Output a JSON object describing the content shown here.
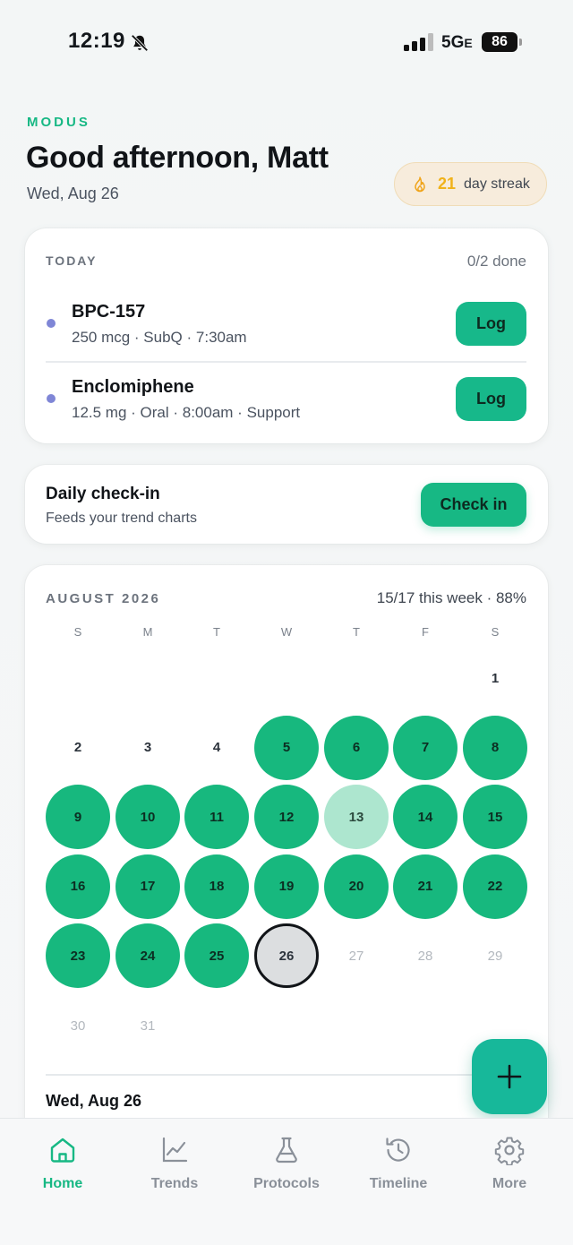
{
  "status_bar": {
    "time": "12:19",
    "network": "5G",
    "network_suffix": "E",
    "battery": "86"
  },
  "header": {
    "brand": "MODUS",
    "greeting": "Good afternoon, Matt",
    "date": "Wed, Aug 26",
    "streak_count": "21",
    "streak_label": "day streak"
  },
  "today": {
    "title": "TODAY",
    "progress": "0/2 done",
    "doses": [
      {
        "name": "BPC-157",
        "detail": "250 mcg · SubQ · 7:30am",
        "button": "Log",
        "dot_color": "#7f86d6"
      },
      {
        "name": "Enclomiphene",
        "detail": "12.5 mg · Oral · 8:00am · Support",
        "button": "Log",
        "dot_color": "#7f86d6"
      }
    ]
  },
  "checkin": {
    "title": "Daily check-in",
    "subtitle": "Feeds your trend charts",
    "button": "Check in"
  },
  "calendar": {
    "month": "AUGUST 2026",
    "summary": "15/17 this week · 88%",
    "weekdays": [
      "S",
      "M",
      "T",
      "W",
      "T",
      "F",
      "S"
    ],
    "days": [
      {
        "n": "1",
        "state": "plain"
      },
      {
        "n": "2",
        "state": "plain"
      },
      {
        "n": "3",
        "state": "plain"
      },
      {
        "n": "4",
        "state": "plain"
      },
      {
        "n": "5",
        "state": "done"
      },
      {
        "n": "6",
        "state": "done"
      },
      {
        "n": "7",
        "state": "done"
      },
      {
        "n": "8",
        "state": "done"
      },
      {
        "n": "9",
        "state": "done"
      },
      {
        "n": "10",
        "state": "done"
      },
      {
        "n": "11",
        "state": "done"
      },
      {
        "n": "12",
        "state": "done"
      },
      {
        "n": "13",
        "state": "partial"
      },
      {
        "n": "14",
        "state": "done"
      },
      {
        "n": "15",
        "state": "done"
      },
      {
        "n": "16",
        "state": "done"
      },
      {
        "n": "17",
        "state": "done"
      },
      {
        "n": "18",
        "state": "done"
      },
      {
        "n": "19",
        "state": "done"
      },
      {
        "n": "20",
        "state": "done"
      },
      {
        "n": "21",
        "state": "done"
      },
      {
        "n": "22",
        "state": "done"
      },
      {
        "n": "23",
        "state": "done"
      },
      {
        "n": "24",
        "state": "done"
      },
      {
        "n": "25",
        "state": "done"
      },
      {
        "n": "26",
        "state": "today"
      },
      {
        "n": "27",
        "state": "future"
      },
      {
        "n": "28",
        "state": "future"
      },
      {
        "n": "29",
        "state": "future"
      },
      {
        "n": "30",
        "state": "future"
      },
      {
        "n": "31",
        "state": "future"
      }
    ],
    "first_weekday": 6,
    "selected_date": "Wed, Aug 26"
  },
  "fab": {
    "icon": "plus-icon"
  },
  "tabs": [
    {
      "label": "Home",
      "icon": "home-icon",
      "active": true
    },
    {
      "label": "Trends",
      "icon": "chart-icon",
      "active": false
    },
    {
      "label": "Protocols",
      "icon": "flask-icon",
      "active": false
    },
    {
      "label": "Timeline",
      "icon": "history-icon",
      "active": false
    },
    {
      "label": "More",
      "icon": "gear-icon",
      "active": false
    }
  ],
  "colors": {
    "accent": "#17b884",
    "done_day": "#17b87e",
    "partial_day": "#ade6cf",
    "streak_bg": "#f7ecdc",
    "streak_text": "#f0b21a",
    "dose_dot": "#7f86d6"
  }
}
